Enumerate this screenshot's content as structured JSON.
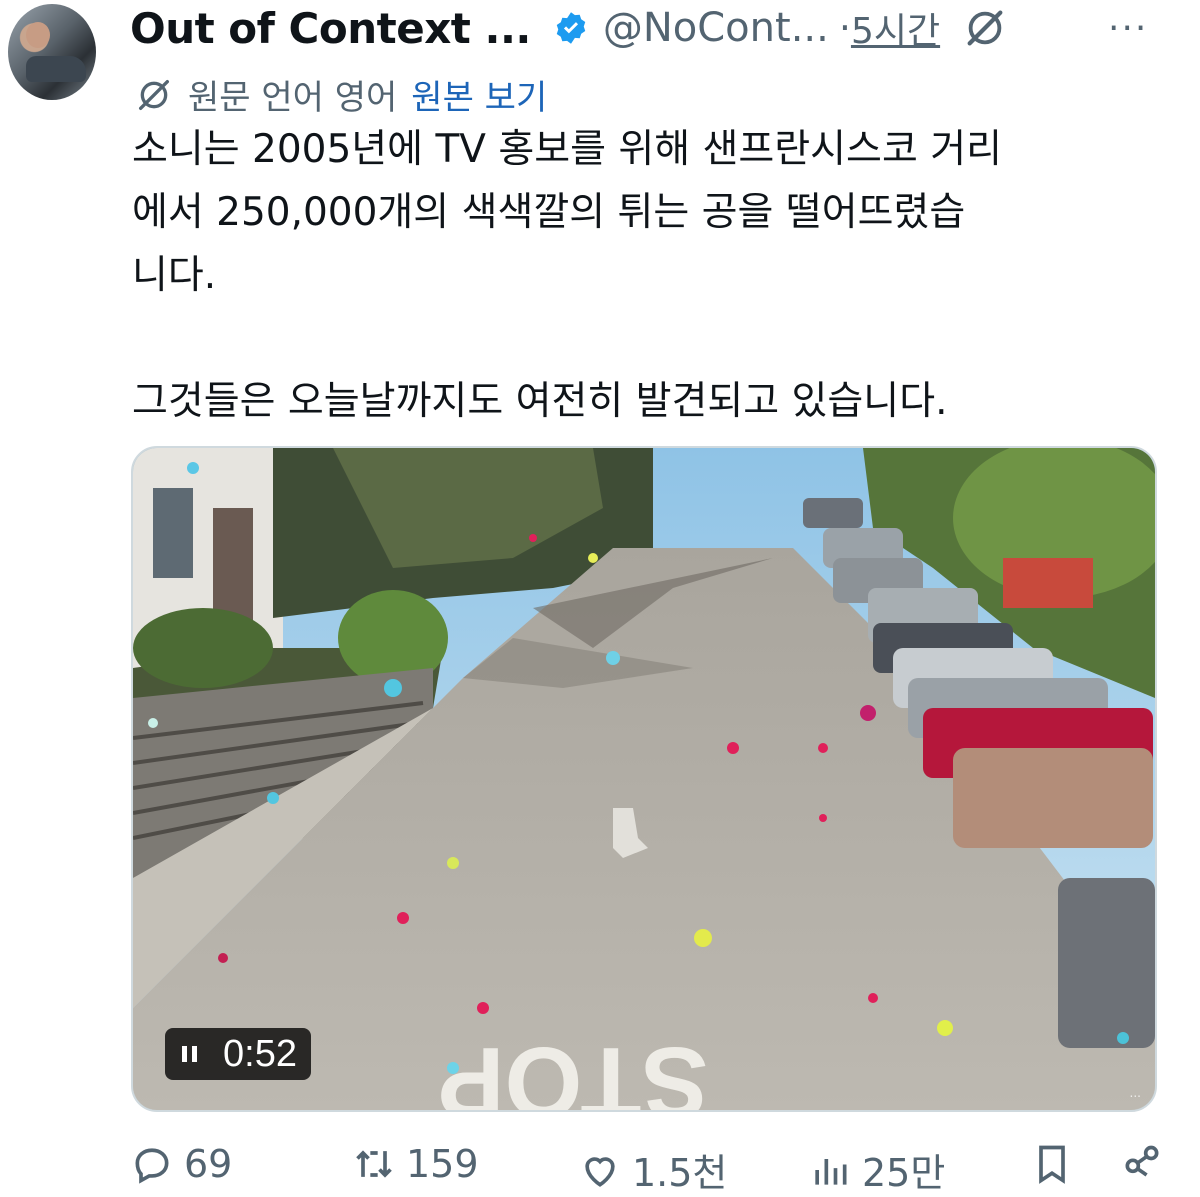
{
  "author": {
    "display_name": "Out of Context ...",
    "handle": "@NoCont...",
    "separator": "·",
    "time": "5시간",
    "more": "···"
  },
  "translation": {
    "label": "원문 언어 영어",
    "link": "원본 보기"
  },
  "tweet": {
    "line1": "소니는 2005년에 TV 홍보를 위해 샌프란시스코 거리",
    "line2": "에서 250,000개의 색색깔의 튀는 공을 떨어뜨렸습",
    "line3": "니다.",
    "line4": "그것들은 오늘날까지도 여전히 발견되고 있습니다."
  },
  "media": {
    "duration": "0:52",
    "street_marking": "STOP",
    "watermark": "...",
    "state_icon": "pause-icon"
  },
  "actions": {
    "replies": "69",
    "retweets": "159",
    "likes": "1.5천",
    "views": "25만"
  },
  "colors": {
    "text": "#0f1419",
    "secondary": "#536471",
    "link": "#1d65b8",
    "verified": "#1d9bf0",
    "border": "#cfd9de"
  }
}
